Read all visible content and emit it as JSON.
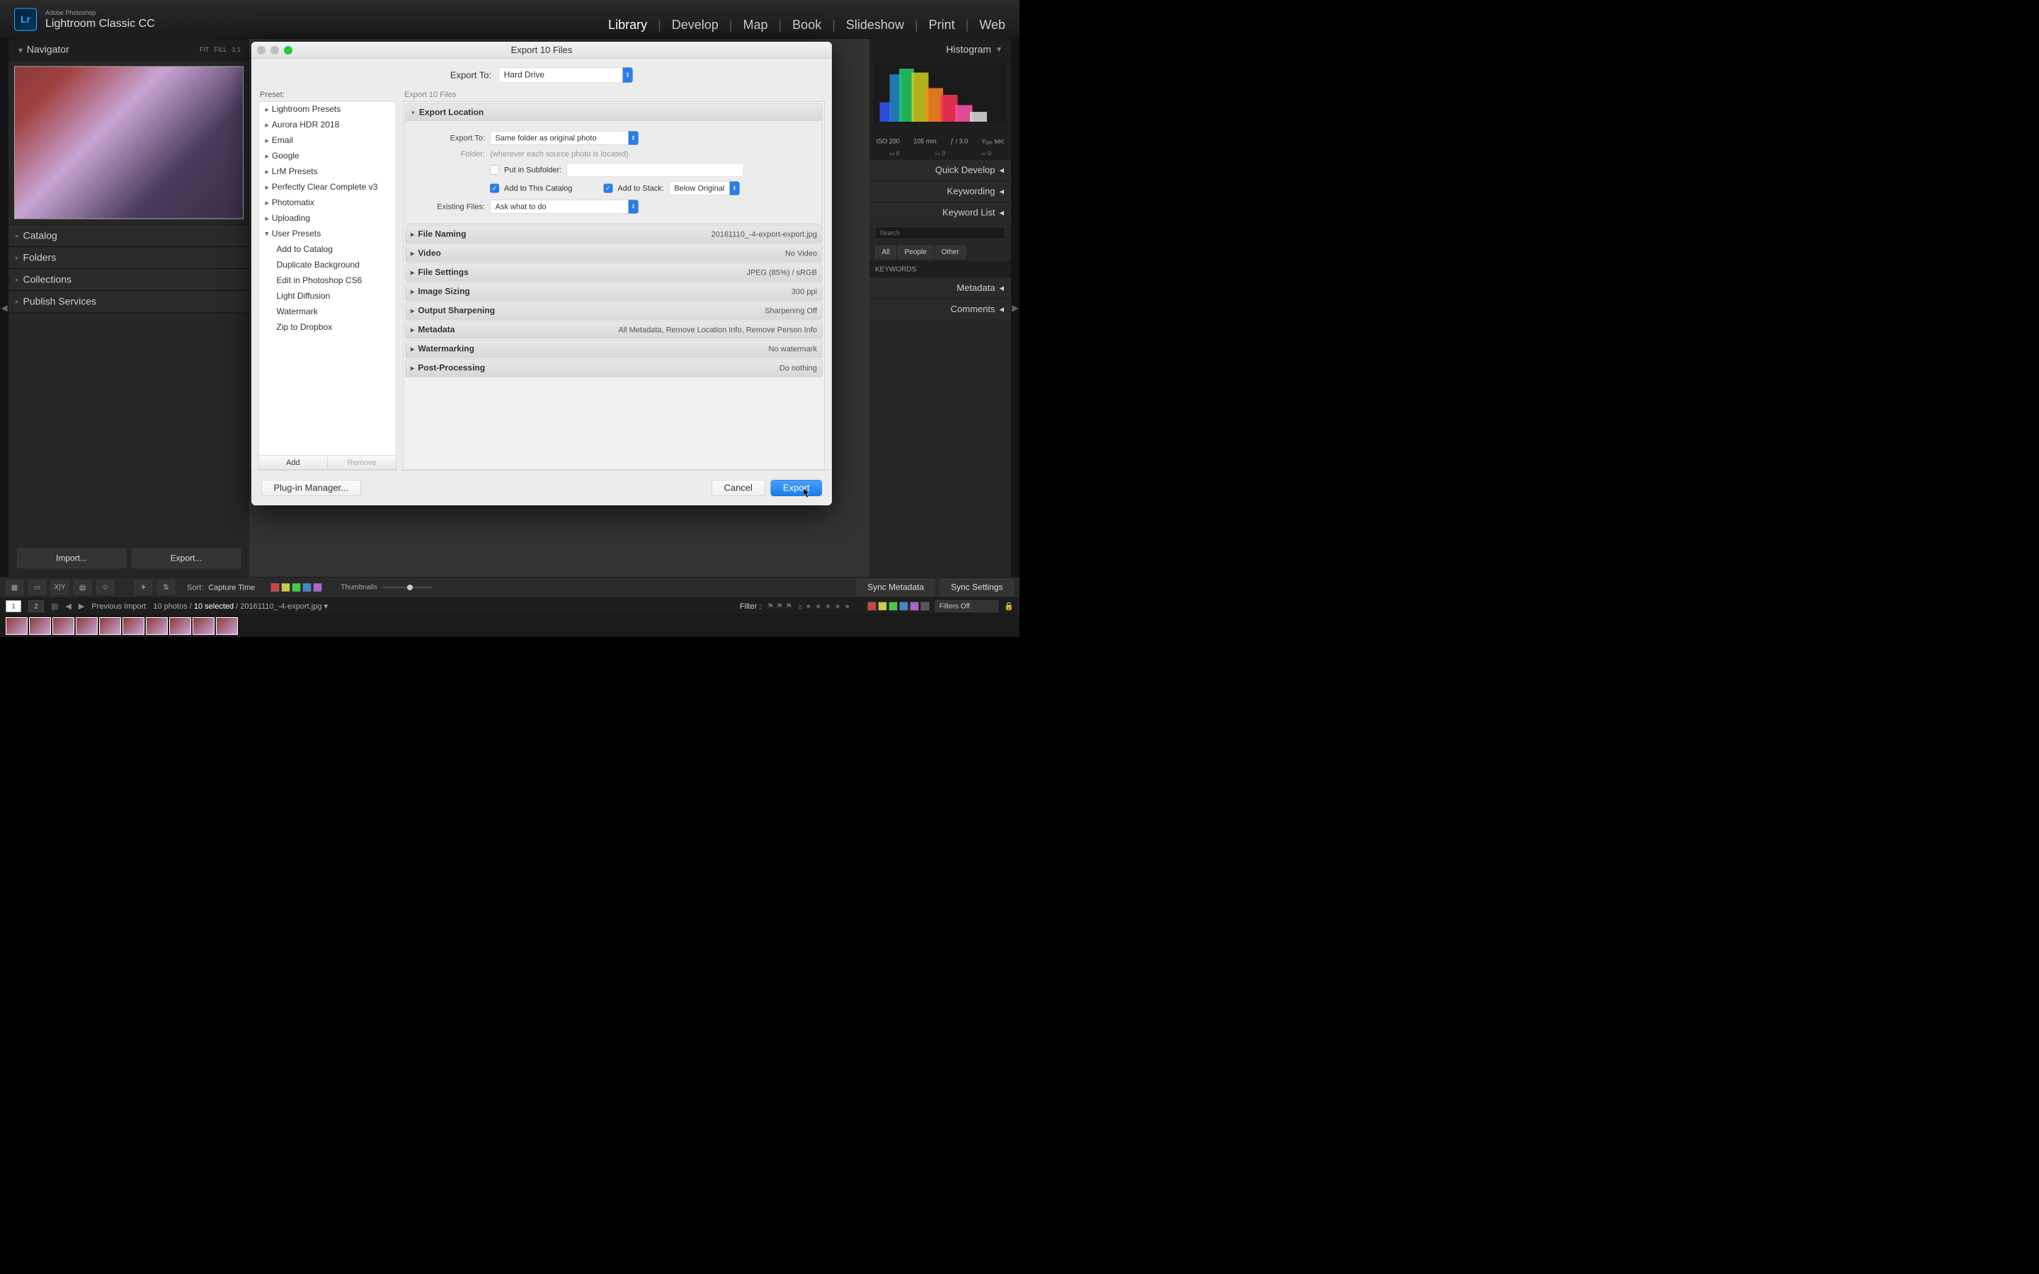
{
  "app": {
    "vendor": "Adobe Photoshop",
    "name": "Lightroom Classic CC",
    "logo": "Lr"
  },
  "modules": [
    "Library",
    "Develop",
    "Map",
    "Book",
    "Slideshow",
    "Print",
    "Web"
  ],
  "active_module": "Library",
  "navigator": {
    "title": "Navigator",
    "opts": [
      "FIT",
      "FILL",
      "1:1"
    ]
  },
  "left_sections": [
    "Catalog",
    "Folders",
    "Collections",
    "Publish Services"
  ],
  "left_buttons": {
    "import": "Import...",
    "export": "Export..."
  },
  "right": {
    "histogram": "Histogram",
    "iso": "ISO 200",
    "focal": "105 mm",
    "aperture": "ƒ / 3.0",
    "shutter": "¹⁄₁₆₀ sec",
    "zeros": [
      "0",
      "0",
      "0"
    ],
    "quick_develop": "Quick Develop",
    "keywording": "Keywording",
    "keyword_list": "Keyword List",
    "kw_tabs": [
      "All",
      "People",
      "Other"
    ],
    "kw_label": "KEYWORDS",
    "metadata": "Metadata",
    "comments": "Comments"
  },
  "toolbar": {
    "sort_label": "Sort:",
    "sort_value": "Capture Time",
    "thumbnails": "Thumbnails",
    "sync_metadata": "Sync Metadata",
    "sync_settings": "Sync Settings",
    "colors": [
      "#c44",
      "#cc4",
      "#4c4",
      "#48c",
      "#a6c"
    ]
  },
  "info": {
    "pages": [
      "1",
      "2"
    ],
    "previous_import": "Previous Import",
    "count": "10 photos /",
    "selected": "10 selected",
    "filename": "/ 20161110_-4-export.jpg",
    "filter_label": "Filter :",
    "filters_off": "Filters Off"
  },
  "dialog": {
    "title": "Export 10 Files",
    "export_to_label": "Export To:",
    "export_to_value": "Hard Drive",
    "preset_label": "Preset:",
    "settings_label": "Export 10 Files",
    "preset_groups": [
      "Lightroom Presets",
      "Aurora HDR 2018",
      "Email",
      "Google",
      "LrM Presets",
      "Perfectly Clear Complete v3",
      "Photomatix",
      "Uploading"
    ],
    "user_presets_label": "User Presets",
    "user_presets": [
      "Add to Catalog",
      "Duplicate Background",
      "Edit in Photoshop CS6",
      "Light Diffusion",
      "Watermark",
      "Zip to Dropbox"
    ],
    "add": "Add",
    "remove": "Remove",
    "sections": {
      "export_location": {
        "title": "Export Location",
        "export_to_label": "Export To:",
        "export_to_value": "Same folder as original photo",
        "folder_label": "Folder:",
        "folder_value": "(wherever each source photo is located)",
        "subfolder_label": "Put in Subfolder:",
        "add_catalog": "Add to This Catalog",
        "add_stack": "Add to Stack:",
        "stack_value": "Below Original",
        "existing_label": "Existing Files:",
        "existing_value": "Ask what to do"
      },
      "file_naming": {
        "title": "File Naming",
        "summary": "20161110_-4-export-export.jpg"
      },
      "video": {
        "title": "Video",
        "summary": "No Video"
      },
      "file_settings": {
        "title": "File Settings",
        "summary": "JPEG (85%) / sRGB"
      },
      "image_sizing": {
        "title": "Image Sizing",
        "summary": "300 ppi"
      },
      "output_sharpening": {
        "title": "Output Sharpening",
        "summary": "Sharpening Off"
      },
      "metadata": {
        "title": "Metadata",
        "summary": "All Metadata, Remove Location Info, Remove Person Info"
      },
      "watermarking": {
        "title": "Watermarking",
        "summary": "No watermark"
      },
      "post_processing": {
        "title": "Post-Processing",
        "summary": "Do nothing"
      }
    },
    "plugin_manager": "Plug-in Manager...",
    "cancel": "Cancel",
    "export": "Export"
  }
}
